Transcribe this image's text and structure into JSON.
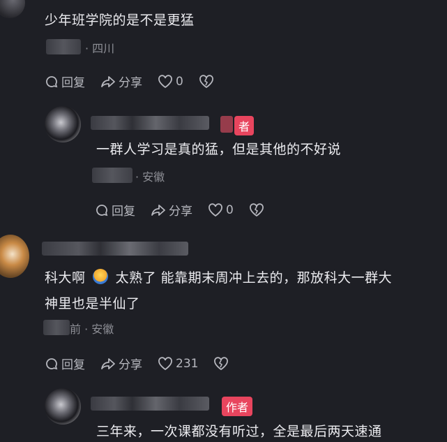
{
  "comments": [
    {
      "text": "少年班学院的是不是更猛",
      "location": "· 四川",
      "actions": {
        "reply": "回复",
        "share": "分享",
        "likes": "0"
      }
    },
    {
      "text": "一群人学习是真的猛，但是其他的不好说",
      "location": "· 安徽",
      "badge": "者",
      "actions": {
        "reply": "回复",
        "share": "分享",
        "likes": "0"
      }
    },
    {
      "text_line1": "科大啊",
      "text_after_emoji": "太熟了 能靠期末周冲上去的，那放科大一群大",
      "text_line2": "神里也是半仙了",
      "location": "前 · 安徽",
      "actions": {
        "reply": "回复",
        "share": "分享",
        "likes": "231"
      }
    },
    {
      "text": "三年来，一次课都没有听过，全是最后两天速通",
      "badge": "作者"
    }
  ],
  "colors": {
    "bg": "#1e1f25",
    "accent": "#e8455e"
  }
}
